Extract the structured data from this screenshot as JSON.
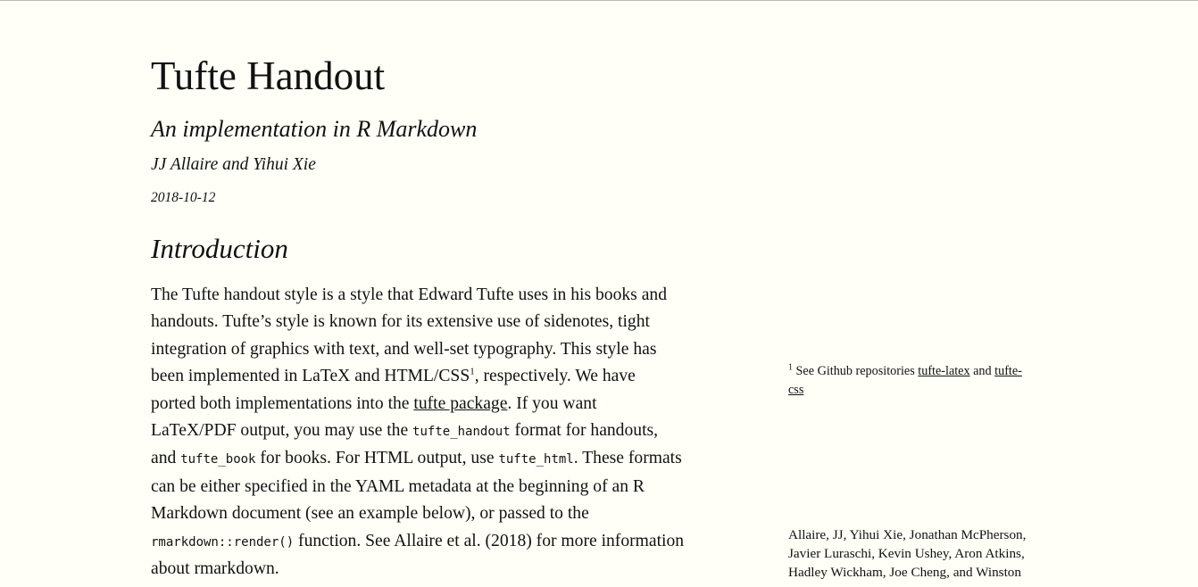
{
  "header": {
    "title": "Tufte Handout",
    "subtitle": "An implementation in R Markdown",
    "author": "JJ Allaire and Yihui Xie",
    "date": "2018-10-12"
  },
  "section": {
    "heading": "Introduction"
  },
  "paragraph": {
    "l1": "The Tufte handout style is a style that Edward Tufte uses in his books and",
    "l2": "handouts. Tufte’s style is known for its extensive use of sidenotes, tight",
    "l3": "integration of graphics with text, and well-set typography. This style has",
    "l4_a": "been implemented in LaTeX and HTML/CSS",
    "l4_sup": "1",
    "l4_b": ", respectively. We have",
    "l5_a": "ported both implementations into the ",
    "l5_link": "tufte package",
    "l5_b": ". If you want",
    "l6_a": "LaTeX/PDF output, you may use the ",
    "l6_code": "tufte_handout",
    "l6_b": " format for handouts,",
    "l7_a": "and ",
    "l7_code1": "tufte_book",
    "l7_b": " for books. For HTML output, use ",
    "l7_code2": "tufte_html",
    "l7_c": ". These formats",
    "l8": "can be either specified in the YAML metadata at the beginning of an R",
    "l9": "Markdown document (see an example below), or passed to the",
    "l10_code": "rmarkdown::render()",
    "l10_b": " function. See Allaire et al. (2018) for more information",
    "l11_a": "about ",
    "l11_strong": "rmarkdown",
    "l11_b": "."
  },
  "sidenote": {
    "number": "1",
    "text_a": " See Github repositories ",
    "link1": "tufte-latex",
    "text_b": " and ",
    "link2_a": "tufte-",
    "link2_b": "css"
  },
  "reference": {
    "l1": "Allaire, JJ, Yihui Xie, Jonathan McPherson,",
    "l2": "Javier Luraschi, Kevin Ushey, Aron Atkins,",
    "l3": "Hadley Wickham, Joe Cheng, and Winston"
  }
}
